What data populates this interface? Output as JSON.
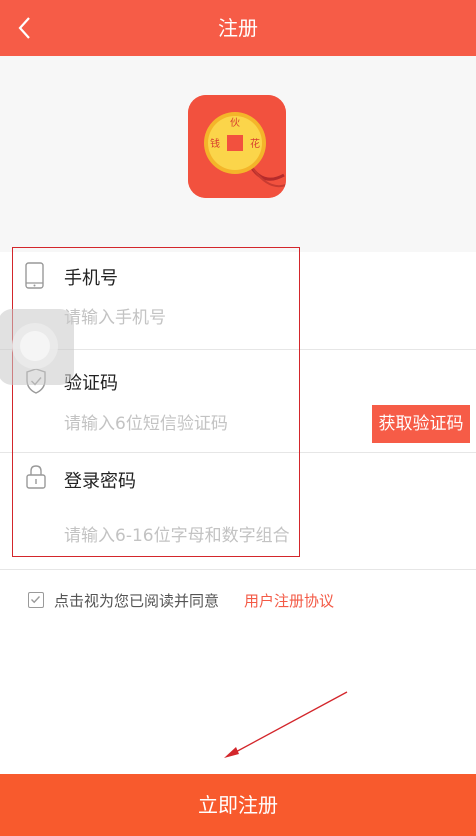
{
  "header": {
    "title": "注册",
    "back_icon": "chevron-left-icon"
  },
  "logo": {
    "coin_chars": [
      "伙",
      "钱",
      "花"
    ],
    "icon": "coin-logo"
  },
  "form": {
    "phone": {
      "label": "手机号",
      "placeholder": "请输入手机号",
      "value": "",
      "icon": "phone-icon"
    },
    "code": {
      "label": "验证码",
      "placeholder": "请输入6位短信验证码",
      "value": "",
      "icon": "shield-icon",
      "button_label": "获取验证码"
    },
    "password": {
      "label": "登录密码",
      "placeholder": "请输入6-16位字母和数字组合",
      "value": "",
      "icon": "lock-icon"
    }
  },
  "agreement": {
    "checked": true,
    "text": "点击视为您已阅读并同意",
    "link_text": "用户注册协议"
  },
  "submit": {
    "label": "立即注册"
  },
  "colors": {
    "primary": "#f65c47",
    "submit": "#f85a2d",
    "annotation": "#d3262b"
  }
}
